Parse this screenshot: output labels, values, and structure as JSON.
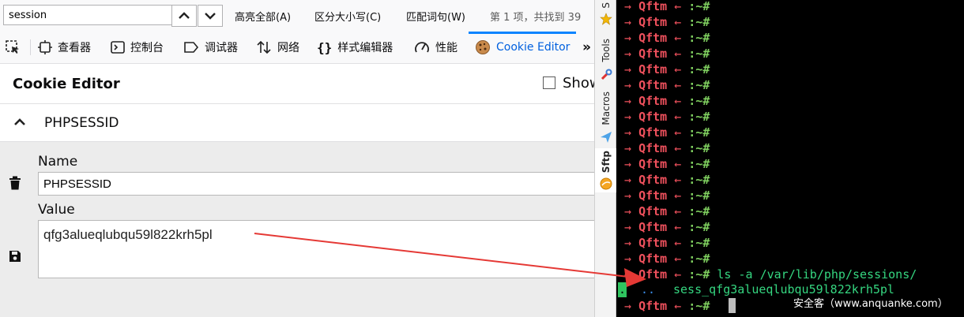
{
  "findbar": {
    "query": "session",
    "highlight_all": "高亮全部(A)",
    "match_case": "区分大小写(C)",
    "whole_words": "匹配词句(W)",
    "status": "第 1 项，共找到 39"
  },
  "devtools_tabs": [
    {
      "label": "查看器",
      "icon": "inspector-icon"
    },
    {
      "label": "控制台",
      "icon": "console-icon"
    },
    {
      "label": "调试器",
      "icon": "debugger-icon"
    },
    {
      "label": "网络",
      "icon": "network-icon"
    },
    {
      "label": "样式编辑器",
      "icon": "style-editor-icon"
    },
    {
      "label": "性能",
      "icon": "performance-icon"
    },
    {
      "label": "Cookie Editor",
      "icon": "cookie-icon",
      "selected": true
    }
  ],
  "overflow_label": "»",
  "cookie_editor": {
    "title": "Cookie Editor",
    "show_label": "Show",
    "cookie_name": "PHPSESSID",
    "name_label": "Name",
    "name_value": "PHPSESSID",
    "value_label": "Value",
    "value_value": "qfg3alueqlubqu59l822krh5pl"
  },
  "sidebar_tabs": [
    {
      "label": "S"
    },
    {
      "label": "Tools"
    },
    {
      "label": "Macros"
    },
    {
      "label": "Sftp",
      "active": true
    }
  ],
  "terminal": {
    "prompt_arrow": "→",
    "host": "Qftm",
    "prompt_left_arrow": "←",
    "path": ":~#",
    "repeated_prompt_count": 17,
    "command": "ls -a /var/lib/php/sessions/",
    "ls_dot": ".",
    "ls_dotdot": "..",
    "ls_file": "sess_qfg3alueqlubqu59l822krh5pl"
  },
  "watermark": "安全客（www.anquanke.com）",
  "colors": {
    "terminal_bg": "#000000",
    "prompt_red": "#f0515d",
    "path_green": "#7fcf5f",
    "command_green": "#35d680",
    "selected_tab_blue": "#0060df",
    "annotation_red": "#e53935"
  }
}
